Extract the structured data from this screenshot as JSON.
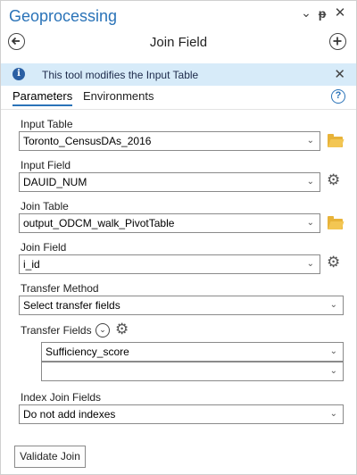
{
  "window": {
    "title": "Geoprocessing",
    "controls": {
      "menu": "⌄",
      "pin": "ᵽ",
      "close": "✕"
    }
  },
  "tool": {
    "title": "Join Field",
    "back_icon": "back-arrow-icon",
    "add_icon": "plus-icon"
  },
  "banner": {
    "message": "This tool modifies the Input Table",
    "close": "✕"
  },
  "tabs": [
    {
      "label": "Parameters",
      "active": true
    },
    {
      "label": "Environments",
      "active": false
    }
  ],
  "help": "?",
  "form": {
    "input_table": {
      "label": "Input Table",
      "value": "Toronto_CensusDAs_2016"
    },
    "input_field": {
      "label": "Input Field",
      "value": "DAUID_NUM"
    },
    "join_table": {
      "label": "Join Table",
      "value": "output_ODCM_walk_PivotTable"
    },
    "join_field": {
      "label": "Join Field",
      "value": "i_id"
    },
    "transfer_method": {
      "label": "Transfer Method",
      "value": "Select transfer fields"
    },
    "transfer_fields": {
      "label": "Transfer Fields",
      "values": [
        "Sufficiency_score",
        ""
      ]
    },
    "index_join_fields": {
      "label": "Index Join Fields",
      "value": "Do not add indexes"
    }
  },
  "validate_button": "Validate Join",
  "colors": {
    "title_blue": "#2a73b8",
    "banner_bg": "#d7ebf9",
    "folder": "#e8b339"
  }
}
